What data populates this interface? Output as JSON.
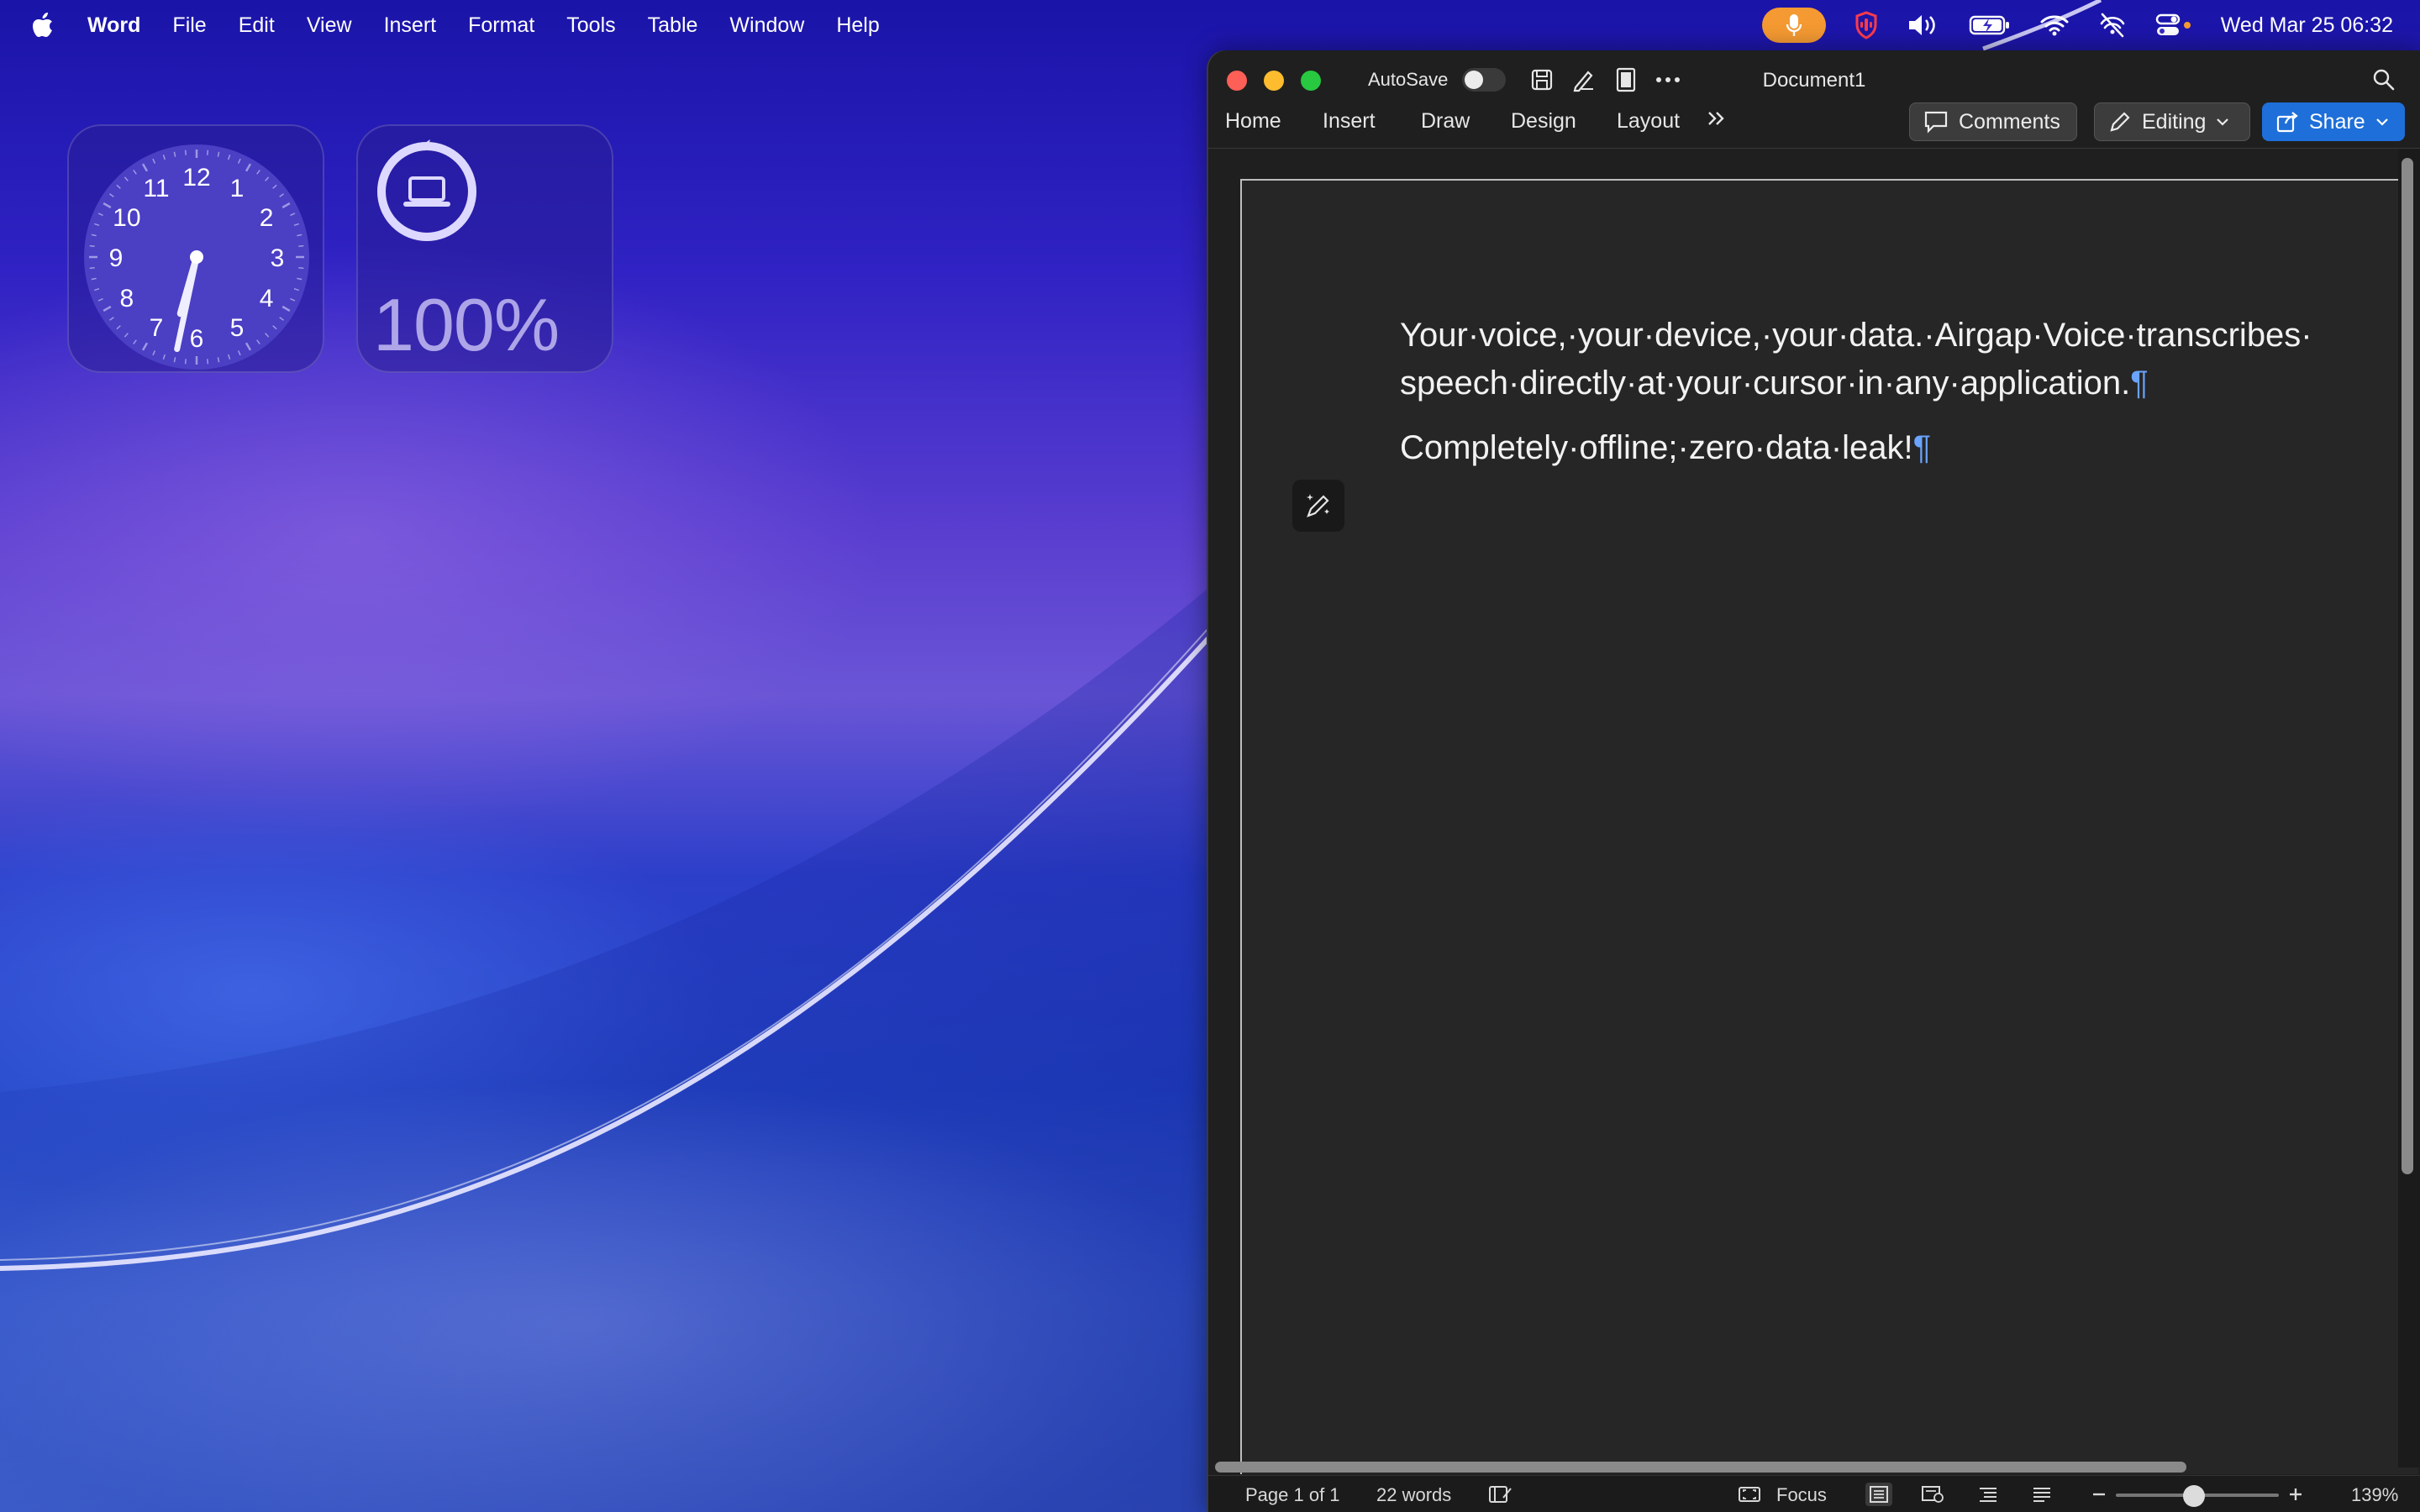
{
  "menubar": {
    "app_name": "Word",
    "items": [
      "File",
      "Edit",
      "View",
      "Insert",
      "Format",
      "Tools",
      "Table",
      "Window",
      "Help"
    ],
    "datetime": "Wed Mar 25  06:32"
  },
  "widgets": {
    "clock": {
      "numbers": [
        "12",
        "1",
        "2",
        "3",
        "4",
        "5",
        "6",
        "7",
        "8",
        "9",
        "10",
        "11"
      ],
      "time": {
        "hour": 6,
        "minute": 32
      }
    },
    "battery": {
      "value": "100%",
      "level": 1.0
    }
  },
  "window": {
    "title": "Document1",
    "autosave_label": "AutoSave",
    "autosave_on": false,
    "ribbon_tabs": [
      "Home",
      "Insert",
      "Draw",
      "Design",
      "Layout"
    ],
    "comments_label": "Comments",
    "editing_label": "Editing",
    "share_label": "Share"
  },
  "document": {
    "paragraph1_line1": "Your·voice,·your·device,·your·data.·Airgap·Voice·transcribes·",
    "paragraph1_line2": "speech·directly·at·your·cursor·in·any·application.",
    "paragraph2": "Completely·offline;·zero·data·leak!",
    "pilcrow": "¶"
  },
  "statusbar": {
    "page": "Page 1 of 1",
    "words": "22 words",
    "focus": "Focus",
    "zoom": "139%"
  },
  "colors": {
    "accent": "#1e6fd9",
    "mic_pill": "#f59a32",
    "pilcrow": "#6aa4ff"
  }
}
